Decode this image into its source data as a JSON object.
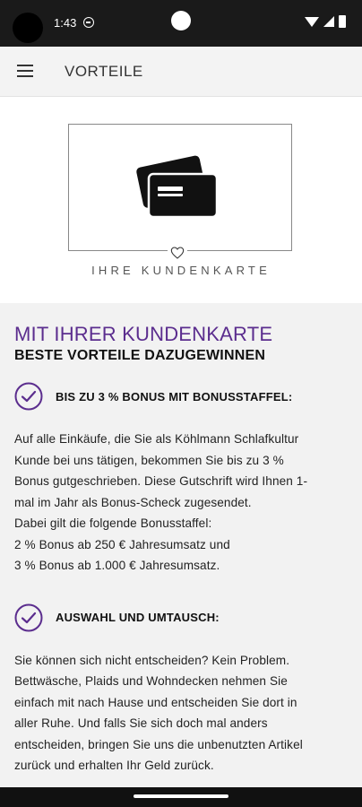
{
  "status_bar": {
    "time": "1:43"
  },
  "app_bar": {
    "title": "VORTEILE"
  },
  "hero": {
    "caption": "IHRE KUNDENKARTE"
  },
  "content": {
    "headline": "MIT IHRER KUNDENKARTE",
    "subheadline": "BESTE VORTEILE DAZUGEWINNEN",
    "benefits": [
      {
        "title": "BIS ZU 3 % BONUS MIT BONUSSTAFFEL:",
        "lines": [
          "Auf alle Einkäufe, die Sie als Köhlmann Schlafkultur",
          "Kunde bei uns tätigen, bekommen Sie bis zu 3 %",
          "Bonus gutgeschrieben. Diese Gutschrift wird Ihnen 1-",
          "mal im Jahr als Bonus-Scheck zugesendet.",
          "Dabei gilt die folgende Bonusstaffel:",
          "2 % Bonus ab 250 € Jahresumsatz und",
          "3 % Bonus ab 1.000 € Jahresumsatz."
        ]
      },
      {
        "title": "AUSWAHL UND UMTAUSCH:",
        "lines": [
          "Sie können sich nicht entscheiden? Kein Problem.",
          "Bettwäsche, Plaids und Wohndecken nehmen Sie",
          "einfach mit nach Hause und entscheiden Sie dort in",
          "aller Ruhe. Und falls Sie sich doch mal anders",
          "entscheiden, bringen Sie uns die unbenutzten Artikel",
          "zurück und erhalten Ihr Geld zurück."
        ]
      }
    ]
  },
  "colors": {
    "accent": "#5b2d8e"
  }
}
